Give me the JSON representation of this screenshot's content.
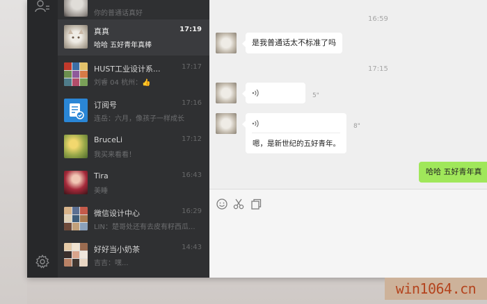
{
  "sidebar": {
    "conversations": [
      {
        "name": "",
        "time": "",
        "preview": "你的普通话真好"
      },
      {
        "name": "真真",
        "time": "17:19",
        "preview": "哈哈 五好青年真棒"
      },
      {
        "name": "HUST工业设计系...",
        "time": "17:17",
        "preview": "刘睿 04 杭州："
      },
      {
        "name": "订阅号",
        "time": "17:16",
        "preview": "连岳：六月，像孩子一样成长"
      },
      {
        "name": "BruceLi",
        "time": "17:12",
        "preview": "我买来看看！"
      },
      {
        "name": "Tira",
        "time": "16:43",
        "preview": "美睡"
      },
      {
        "name": "微信设计中心",
        "time": "16:29",
        "preview": "LIN：楚哥处还有去皮有籽西瓜..."
      },
      {
        "name": "好好当小奶茶",
        "time": "14:43",
        "preview": "吉吉：嘿..."
      }
    ]
  },
  "chat": {
    "timestamps": [
      "16:59",
      "17:15"
    ],
    "messages": [
      {
        "type": "text",
        "text": "是我普通话太不标准了吗"
      },
      {
        "type": "voice",
        "duration": "5\""
      },
      {
        "type": "voice",
        "duration": "8\"",
        "transcript": "嗯，是新世纪的五好青年。"
      }
    ],
    "outgoing": "哈哈 五好青年真"
  },
  "icons": {
    "contacts": "contacts-icon",
    "settings": "gear-icon",
    "emoji": "emoji-icon",
    "screenshot": "scissors-icon",
    "file": "file-icon",
    "thumbs_up": "thumbs-up-emoji",
    "article": "article-icon"
  },
  "colors": {
    "accent": "#a0e75a",
    "sidebar": "#2f3032",
    "nav": "#27282a",
    "chat_bg": "#efefef"
  },
  "watermark": "win1064.cn"
}
